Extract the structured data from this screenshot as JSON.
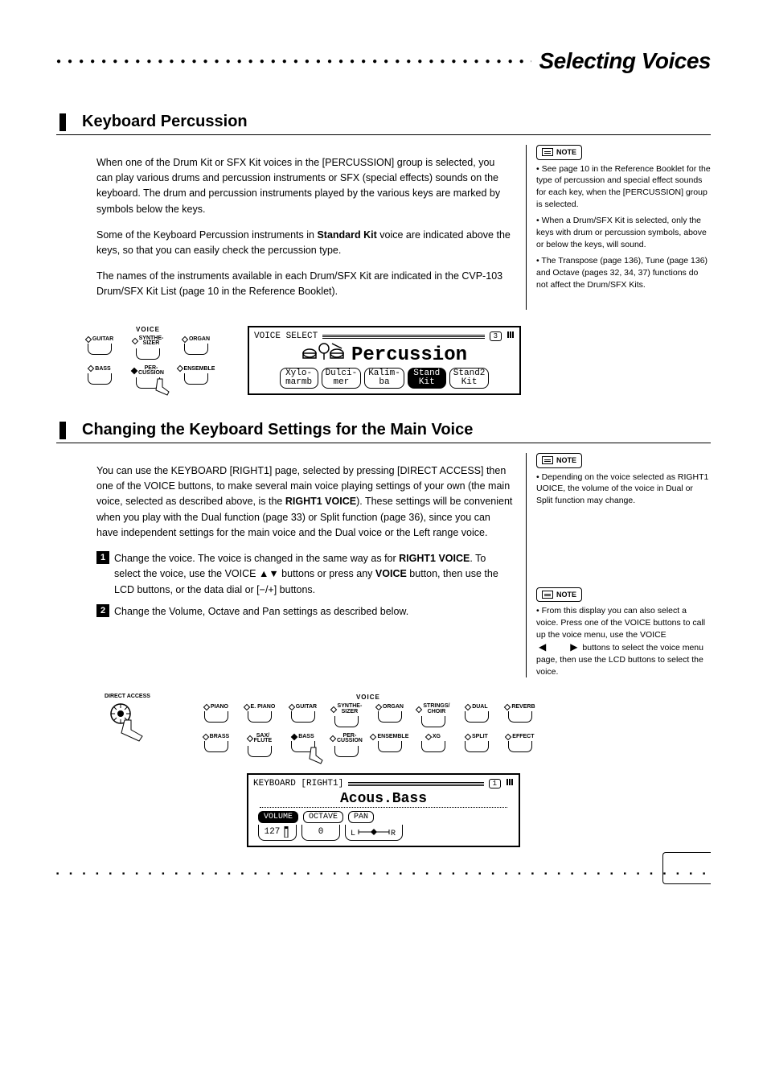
{
  "header": {
    "title": "Selecting Voices"
  },
  "section1": {
    "title": "Keyboard Percussion",
    "p1": "When one of the Drum Kit or SFX Kit voices in the [PERCUSSION] group is selected, you can play various drums and percussion instruments or SFX (special effects) sounds on the keyboard. The drum and percussion instruments played by the various keys are marked by symbols below the keys.",
    "p2_a": "Some of the Keyboard Percussion instruments in ",
    "p2_b": "Standard Kit",
    "p2_c": " voice are indicated above the keys, so that you can easily check the percussion type.",
    "p3": "The names of the instruments available in each Drum/SFX Kit are indicated in the CVP-103 Drum/SFX Kit List (page 10 in the Reference Booklet).",
    "note1": "• See page 10 in the Reference Booklet for the type of percussion and special effect sounds for each key, when the [PERCUSSION] group is selected.",
    "note2": "• When a Drum/SFX Kit is selected, only the keys with drum or percussion symbols, above or below the keys, will sound.",
    "note3": "• The Transpose (page 136), Tune (page 136) and Octave (pages 32, 34, 37) functions do not affect the Drum/SFX Kits.",
    "voice_label": "VOICE",
    "buttons_top": [
      "GUITAR",
      "SYNTHE-\nSIZER",
      "ORGAN"
    ],
    "buttons_bot": [
      "BASS",
      "PER-\nCUSSION",
      "ENSEMBLE"
    ],
    "lcd": {
      "title": "VOICE SELECT",
      "tab_ind": "3",
      "big": "Percussion",
      "tabs": [
        "Xylo-\nmarmb",
        "Dulci-\nmer",
        "Kalim-\nba",
        "Stand\nKit",
        "Stand2\nKit"
      ],
      "selected_idx": 3
    }
  },
  "section2": {
    "title": "Changing the Keyboard Settings for the Main Voice",
    "p1_a": "You can use the KEYBOARD [RIGHT1] page, selected by pressing [DIRECT ACCESS] then one of the VOICE buttons, to make several main voice playing settings of your own (the main voice, selected as described above, is the ",
    "p1_b": "RIGHT1 VOICE",
    "p1_c": "). These settings will be convenient when you play with the Dual function (page 33) or Split function (page 36), since you can have independent settings for the main voice and the Dual voice or the Left range voice.",
    "step1_a": "Change the voice. The voice is changed in the same way as for ",
    "step1_b": "RIGHT1 VOICE",
    "step1_c": ". To select the voice, use the VOICE ▲▼ buttons or press any ",
    "step1_d": "VOICE",
    "step1_e": " button, then use the LCD buttons, or the data dial or [−/+] buttons.",
    "step2": "Change the Volume, Octave and Pan settings as described below.",
    "note1": "• Depending on the voice selected as RIGHT1 UOICE, the volume of the voice in Dual or Split function may change.",
    "note2_a": "• From this display you can also select a voice. Press one of the VOICE buttons to call up the voice menu, use the VOICE ",
    "note2_b": " buttons to select the voice menu page, then use the LCD buttons to select the voice.",
    "direct_access": "DIRECT ACCESS",
    "voice_label": "VOICE",
    "voice_top": [
      "PIANO",
      "E. PIANO",
      "GUITAR",
      "SYNTHE-\nSIZER",
      "ORGAN",
      "STRINGS/\nCHOIR",
      "DUAL",
      "REVERB"
    ],
    "voice_bot": [
      "BRASS",
      "SAX/\nFLUTE",
      "BASS",
      "PER-\nCUSSION",
      "ENSEMBLE",
      "XG",
      "SPLIT",
      "EFFECT"
    ],
    "lcd2": {
      "title": "KEYBOARD [RIGHT1]",
      "tab_ind": "1",
      "big": "Acous.Bass",
      "tabs": [
        "VOLUME",
        "OCTAVE",
        "PAN"
      ],
      "vals": [
        "127",
        "0",
        ""
      ]
    }
  },
  "note_label": "NOTE",
  "triangles": {
    "left": "◀",
    "right": "▶"
  }
}
